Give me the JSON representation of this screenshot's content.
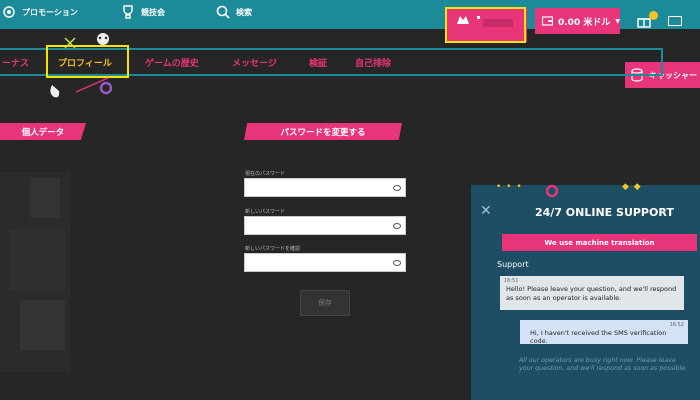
{
  "topbar": {
    "promotions": "プロモーション",
    "tournaments": "競技会",
    "search": "検索",
    "balance": "0.00 米ドル",
    "cashier": "キャッシャー"
  },
  "nav": {
    "bonus": "ーナス",
    "profile": "プロフィール",
    "game_history": "ゲームの歴史",
    "messages": "メッセージ",
    "verification": "検証",
    "self_exclusion": "自己排除"
  },
  "personal": {
    "heading": "個人データ"
  },
  "password": {
    "heading": "パスワードを変更する",
    "current_label": "現在のパスワード",
    "new_label": "新しいパスワード",
    "confirm_label": "新しいパスワードを確認",
    "save": "保存"
  },
  "chat": {
    "title": "24/7 ONLINE SUPPORT",
    "banner": "We use machine translation",
    "support_label": "Support",
    "msg1_time": "16:51",
    "msg1": "Hello! Please leave your question, and we'll respond as soon as an operator is available.",
    "msg2_time": "16:52",
    "msg2": "Hi, I haven't received the SMS verification code.",
    "busy": "All our operators are busy right now. Please leave your question, and we'll respond as soon as possible."
  },
  "colors": {
    "accent": "#e8357a",
    "teal": "#1d8a99",
    "highlight": "#f2e600"
  }
}
